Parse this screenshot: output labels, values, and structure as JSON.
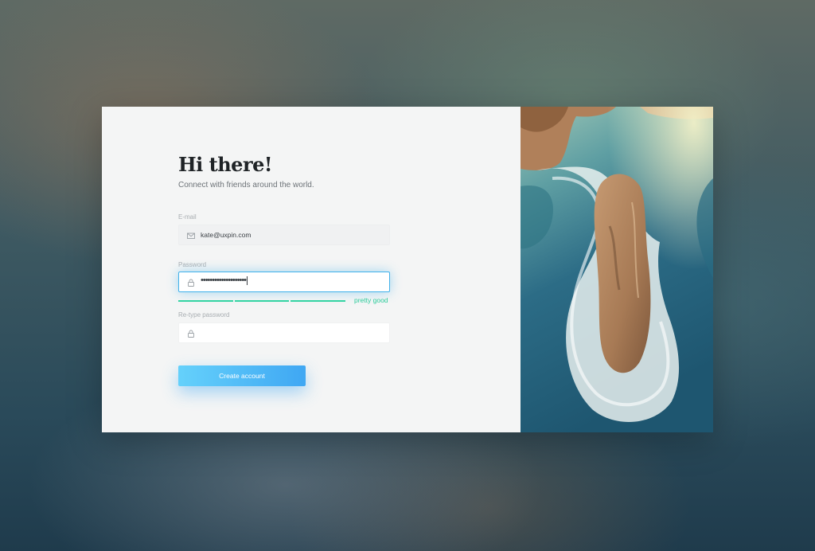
{
  "heading": "Hi there!",
  "subheading": "Connect with friends around the world.",
  "email": {
    "label": "E-mail",
    "value": "kate@uxpin.com",
    "icon": "mail-icon"
  },
  "password": {
    "label": "Password",
    "masked_value": "••••••••••••••••••••",
    "icon": "lock-icon",
    "strength_label": "pretty good",
    "strength_segments_filled": 3,
    "strength_segments_total": 3
  },
  "retype_password": {
    "label": "Re-type password",
    "value": "",
    "icon": "lock-icon"
  },
  "submit_label": "Create account",
  "colors": {
    "accent": "#41b1ea",
    "button_gradient_start": "#65d1fb",
    "button_gradient_end": "#3fa7f3",
    "strength_good": "#34d4a3"
  }
}
